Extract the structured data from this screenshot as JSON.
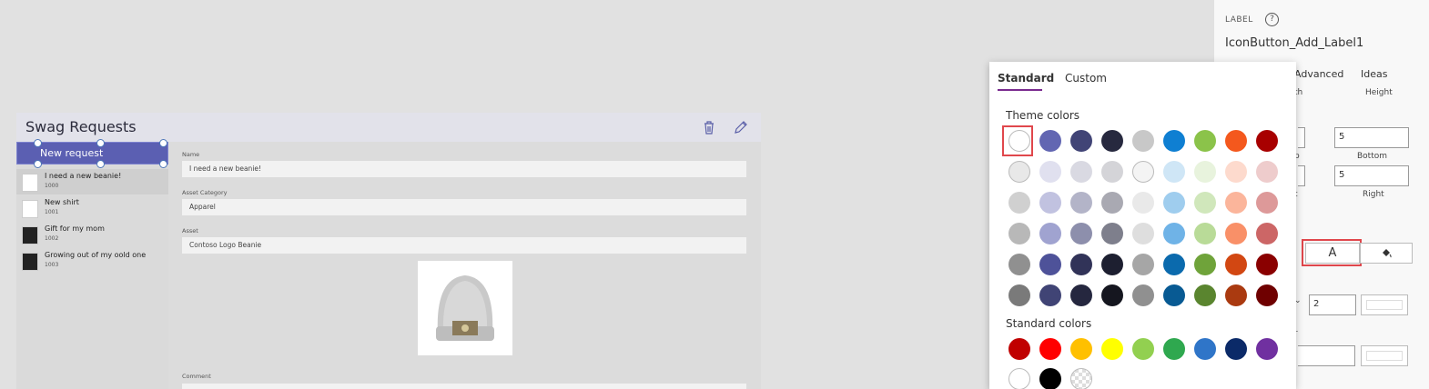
{
  "app": {
    "title": "Swag Requests",
    "new_request_label": "New request",
    "items": [
      {
        "title": "I need a new beanie!",
        "id": "1000"
      },
      {
        "title": "New shirt",
        "id": "1001"
      },
      {
        "title": "Gift for my mom",
        "id": "1002"
      },
      {
        "title": "Growing out of my oold one",
        "id": "1003"
      }
    ],
    "form": {
      "name_label": "Name",
      "name_value": "I need a new beanie!",
      "category_label": "Asset Category",
      "category_value": "Apparel",
      "asset_label": "Asset",
      "asset_value": "Contoso Logo Beanie",
      "comment_label": "Comment"
    },
    "header_icons": [
      "trash-icon",
      "edit-pencil-icon"
    ]
  },
  "panel": {
    "section_label": "LABEL",
    "control_name": "IconButton_Add_Label1",
    "tabs": [
      "Advanced",
      "Ideas"
    ],
    "width_label_fragment": "th",
    "height_label": "Height",
    "top_label_fragment": "p",
    "bottom_label": "Bottom",
    "left_label_fragment": "t",
    "right_label": "Right",
    "padding_top_value": "5",
    "padding_bottom_value": "5",
    "font_color_glyph": "A",
    "fill_icon": "paint-bucket-icon",
    "border_thickness_value": "2",
    "border_label_fragment": "r"
  },
  "picker": {
    "tabs": [
      "Standard",
      "Custom"
    ],
    "active_tab": "Standard",
    "theme_colors_label": "Theme colors",
    "standard_colors_label": "Standard colors",
    "theme_rows": [
      [
        "#ffffff",
        "#6266b2",
        "#414476",
        "#27293f",
        "#c8c8c8",
        "#0f7fd2",
        "#8bc34a",
        "#f4581d",
        "#a80000"
      ],
      [
        "#e8e8e8",
        "#e0e0ef",
        "#d9d9e2",
        "#d4d4d8",
        "#f4f4f4",
        "#cfe6f6",
        "#e8f3dd",
        "#fddacd",
        "#eecccc"
      ],
      [
        "#d0d0d0",
        "#c1c2e0",
        "#b3b4c8",
        "#a9a9b2",
        "#e9e9e9",
        "#9fcdee",
        "#d0e7bb",
        "#fbb59b",
        "#dd9999"
      ],
      [
        "#b8b8b8",
        "#a0a3d0",
        "#8d8fac",
        "#7e7f8c",
        "#dedede",
        "#6fb3e7",
        "#b9db98",
        "#f99068",
        "#cc6666"
      ],
      [
        "#909090",
        "#4e5299",
        "#313358",
        "#1d1f30",
        "#a6a6a6",
        "#0b6aad",
        "#6fa33a",
        "#d24712",
        "#8a0000"
      ],
      [
        "#7a7a7a",
        "#404475",
        "#25273f",
        "#15161f",
        "#909090",
        "#085a93",
        "#5a852f",
        "#aa3a10",
        "#6f0000"
      ]
    ],
    "standard_rows": [
      [
        "#c00000",
        "#ff0000",
        "#ffc000",
        "#ffff00",
        "#92d050",
        "#2fa84f",
        "#2f75c8",
        "#0b2a68",
        "#7030a0"
      ],
      [
        "#ffffff",
        "#000000",
        "transparent"
      ]
    ]
  }
}
